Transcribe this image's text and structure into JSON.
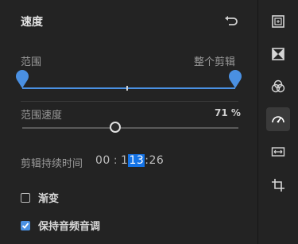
{
  "panel": {
    "title": "速度",
    "reset_icon": "undo-icon"
  },
  "range": {
    "label": "范围",
    "scope": "整个剪辑"
  },
  "speed": {
    "label": "范围速度",
    "value": "71 %"
  },
  "duration": {
    "label": "剪辑持续时间",
    "hours": "00",
    "sep1": ":",
    "minutes_pre": "1",
    "minutes_sel": "13",
    "sep2": ":",
    "frames": "26"
  },
  "options": {
    "ramp_label": "渐变",
    "ramp_checked": false,
    "pitch_label": "保持音频音调",
    "pitch_checked": true
  },
  "colors": {
    "accent": "#4a90e2",
    "selection": "#1473e6",
    "background": "#232323"
  },
  "sidebar": {
    "items": [
      {
        "icon": "crop-frame-icon",
        "active": false
      },
      {
        "icon": "flip-icon",
        "active": false
      },
      {
        "icon": "color-circles-icon",
        "active": false
      },
      {
        "icon": "speedometer-icon",
        "active": true
      },
      {
        "icon": "resize-arrows-icon",
        "active": false
      },
      {
        "icon": "crop-icon",
        "active": false
      }
    ]
  }
}
